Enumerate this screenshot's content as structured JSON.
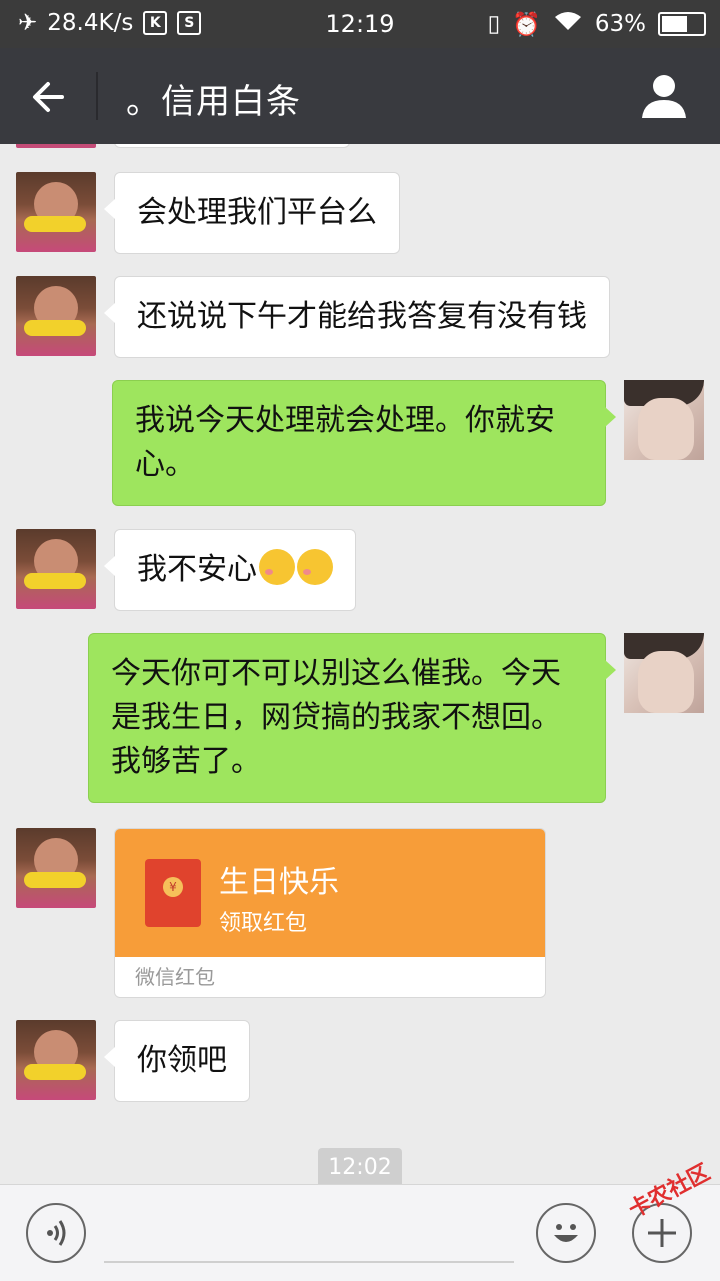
{
  "status_bar": {
    "network_speed": "28.4K/s",
    "app_badges": [
      "K",
      "S"
    ],
    "time": "12:19",
    "battery": "63%",
    "battery_level": 0.63
  },
  "header": {
    "title": "。信用白条"
  },
  "messages": [
    {
      "from": "other",
      "text": "会处理我们平台么"
    },
    {
      "from": "other",
      "text": "还说说下午才能给我答复有没有钱"
    },
    {
      "from": "me",
      "text": "我说今天处理就会处理。你就安心。"
    },
    {
      "from": "other",
      "text": "我不安心"
    },
    {
      "from": "me",
      "text": "今天你可不可以别这么催我。今天是我生日，网贷搞的我家不想回。我够苦了。"
    },
    {
      "from": "other",
      "type": "red_packet",
      "title": "生日快乐",
      "subtitle": "领取红包",
      "footer": "微信红包"
    },
    {
      "from": "other",
      "text": "你领吧"
    }
  ],
  "timestamp": "12:02",
  "watermark": "卡农社区",
  "colors": {
    "status_bar": "#3b3b3b",
    "title_bar": "#393a3f",
    "chat_background": "#ebebeb",
    "outgoing_bubble": "#9ee55e",
    "incoming_bubble": "#ffffff",
    "red_packet": "#f79d39"
  }
}
